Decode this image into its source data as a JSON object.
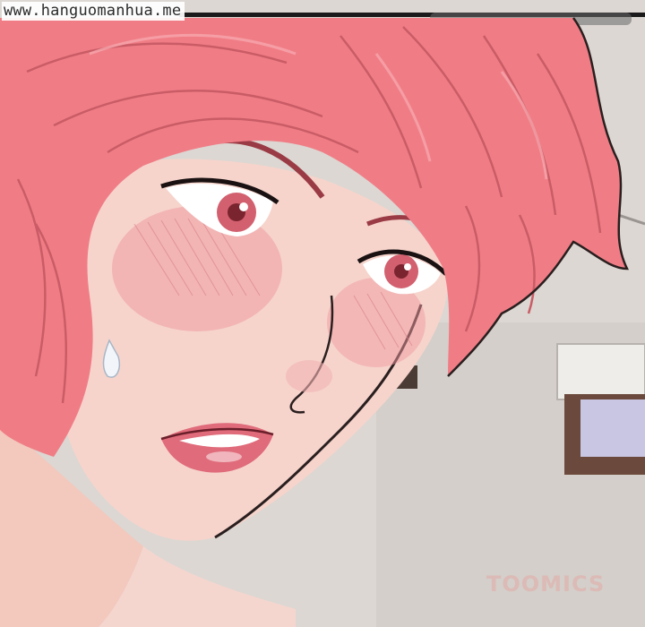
{
  "watermarks": {
    "source_url": "www.hanguomanhua.me",
    "brand": "TOOMICS"
  },
  "colors": {
    "wall": "#d8d3ce",
    "hair": "#f07d86",
    "hair_dark": "#c95c66",
    "skin": "#f6d4cc",
    "blush": "#ef9aa0",
    "iris": "#d2606f",
    "lips": "#e06b7a",
    "window_frame": "#6b4a3d",
    "window_glass": "#c9c6e3"
  }
}
